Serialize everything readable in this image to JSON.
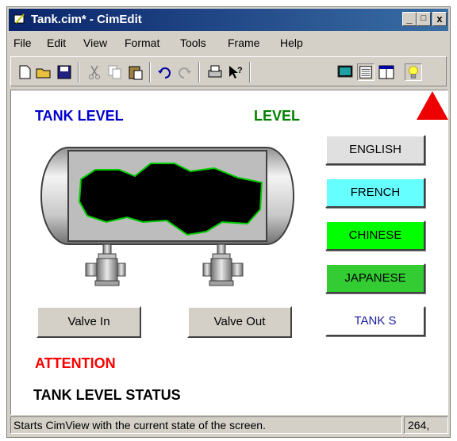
{
  "window": {
    "title": "Tank.cim* - CimEdit"
  },
  "titlebar_buttons": {
    "minimize": "_",
    "maximize": "□",
    "close": "x"
  },
  "menu": [
    "File",
    "Edit",
    "View",
    "Format",
    "Tools",
    "Frame",
    "Help"
  ],
  "canvas": {
    "tank_level_title": "TANK LEVEL",
    "level_label": "LEVEL",
    "languages": [
      {
        "label": "ENGLISH",
        "color": "#e0e0e0",
        "text_color": "#000000"
      },
      {
        "label": "FRENCH",
        "color": "#66ffff",
        "text_color": "#000000"
      },
      {
        "label": "CHINESE",
        "color": "#00ff00",
        "text_color": "#000000"
      },
      {
        "label": "JAPANESE",
        "color": "#33cc33",
        "text_color": "#000000"
      },
      {
        "label": "TANK S",
        "color": "#ffffff",
        "text_color": "#1a1aa0"
      }
    ],
    "valve_in": "Valve In",
    "valve_out": "Valve Out",
    "attention": "ATTENTION",
    "tank_level_status": "TANK LEVEL STATUS"
  },
  "colors": {
    "title_blue": "#0000cc",
    "level_green": "#008000",
    "attention_red": "#ff0000",
    "liquid": "#000000",
    "liquid_edge": "#00cc00"
  },
  "statusbar": {
    "text": "Starts CimView with the current state of the screen.",
    "coord": "264,"
  }
}
